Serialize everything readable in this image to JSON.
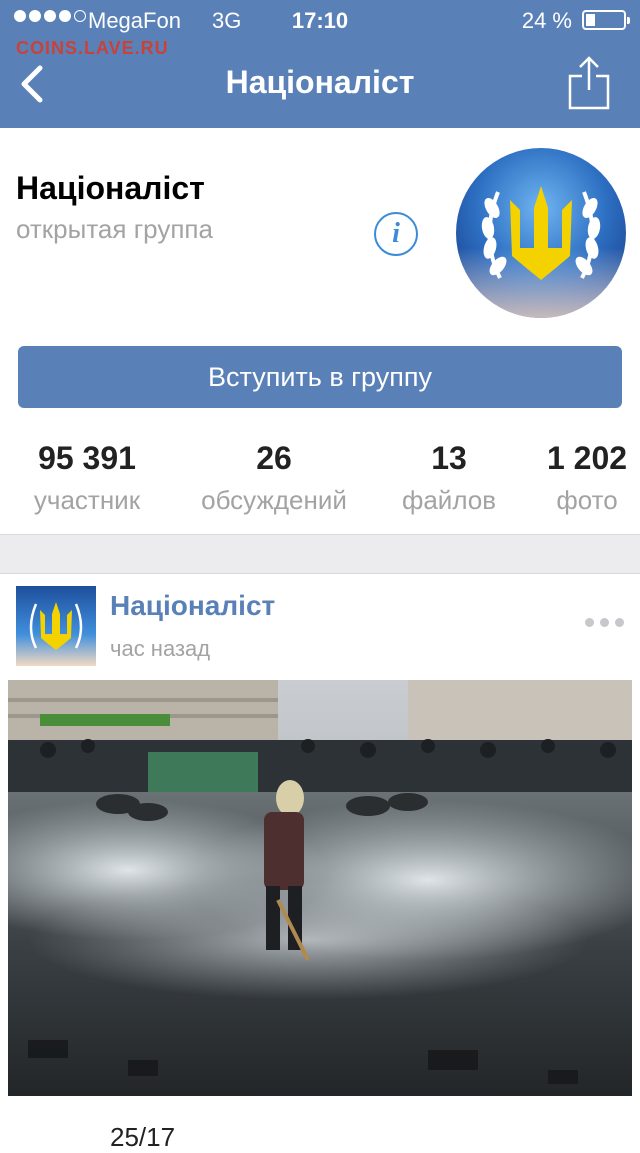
{
  "status_bar": {
    "carrier": "MegaFon",
    "network": "3G",
    "time": "17:10",
    "battery": "24 %",
    "battery_level": 0.24,
    "signal_bars": 4
  },
  "watermark": "COINS.LAVE.RU",
  "nav": {
    "title": "Націоналіст"
  },
  "group": {
    "name": "Націоналіст",
    "type": "открытая группа",
    "info_glyph": "i"
  },
  "join_button": "Вступить в группу",
  "stats": [
    {
      "value": "95 391",
      "label": "участник"
    },
    {
      "value": "26",
      "label": "обсуждений"
    },
    {
      "value": "13",
      "label": "файлов"
    },
    {
      "value": "1 202",
      "label": "фото"
    }
  ],
  "post": {
    "author": "Націоналіст",
    "time": "час назад",
    "text": "25/17"
  },
  "colors": {
    "header": "#5a81b7",
    "accent_text": "#5a81b7",
    "secondary_text": "#a3a3a3",
    "info_icon": "#3b8bd6",
    "watermark": "#c9423a"
  }
}
